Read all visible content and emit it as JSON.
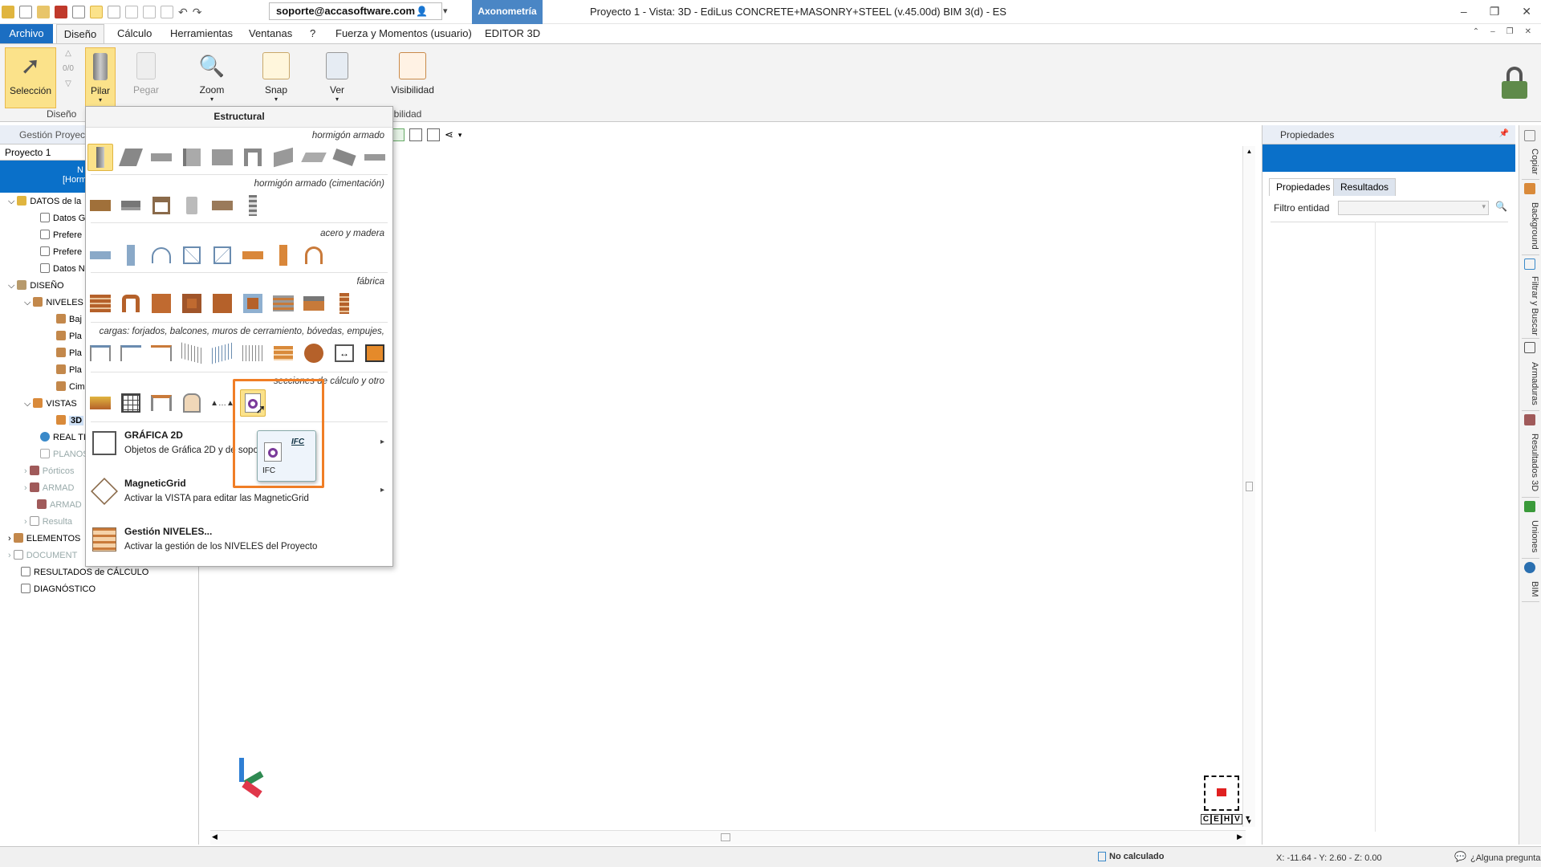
{
  "titlebar": {
    "user_email": "soporte@accasoftware.com",
    "context_tab": "Axonometría",
    "window_title": "Proyecto 1 -  Vista: 3D - EdiLus CONCRETE+MASONRY+STEEL (v.45.00d) BIM 3(d) - ES"
  },
  "menu_tabs": [
    "Archivo",
    "Diseño",
    "Cálculo",
    "Herramientas",
    "Ventanas",
    "?",
    "Fuerza y Momentos (usuario)",
    "EDITOR 3D"
  ],
  "ribbon": {
    "seleccion": "Selección",
    "counter": "0/0",
    "pilar": "Pilar",
    "pegar": "Pegar",
    "zoom": "Zoom",
    "snap": "Snap",
    "ver": "Ver",
    "visibilidad": "Visibilidad",
    "group_diseno": "Diseño",
    "group_visibilidad": "ibilidad"
  },
  "left_panel": {
    "title": "Gestión Proyecto",
    "project_select": "Proyecto 1",
    "band_line1": "N",
    "band_line2": "[Horm",
    "tree": [
      "DATOS de la",
      "Datos G",
      "Prefere",
      "Prefere",
      "Datos N",
      "DISEÑO",
      "NIVELES",
      "Baj",
      "Pla",
      "Pla",
      "Pla",
      "Cim",
      "VISTAS",
      "3D",
      "REAL TI",
      "PLANOS",
      "Pórticos",
      "ARMAD",
      "ARMAD",
      "Resulta",
      "ELEMENTOS",
      "DOCUMENT",
      "RESULTADOS de CÁLCULO",
      "DIAGNÓSTICO"
    ]
  },
  "dropdown": {
    "header": "Estructural",
    "categories": [
      "hormigón armado",
      "hormigón armado (cimentación)",
      "acero y madera",
      "fábrica",
      "cargas: forjados, balcones, muros de cerramiento, bóvedas, empujes,",
      "secciones de cálculo y otro"
    ],
    "items": [
      {
        "title": "GRÁFICA 2D",
        "desc": "Objetos de Gráfica 2D y de sopo"
      },
      {
        "title": "MagneticGrid",
        "desc": "Activar la VISTA para editar las MagneticGrid"
      },
      {
        "title": "Gestión NIVELES...",
        "desc": "Activar la gestión de los NIVELES del Proyecto"
      }
    ],
    "ifc_label": "IFC",
    "ifc_tag": "IFC"
  },
  "right_panel": {
    "title": "Propiedades",
    "tab_on": "Propiedades",
    "tab_off": "Resultados",
    "filter_label": "Filtro entidad"
  },
  "sidebar_tabs": [
    "Copiar",
    "Background",
    "Filtrar y Buscar",
    "Armaduras",
    "Resultados 3D",
    "Uniones",
    "BIM"
  ],
  "status": {
    "calc": "No calculado",
    "coords": "X: -11.64 - Y: 2.60 - Z: 0.00",
    "help": "¿Alguna pregunta?"
  },
  "cube_labels": [
    "C",
    "E",
    "H",
    "V"
  ],
  "colors": {
    "accent": "#0a70c9",
    "highlight": "#f07e26",
    "selected": "#fbe28a"
  }
}
